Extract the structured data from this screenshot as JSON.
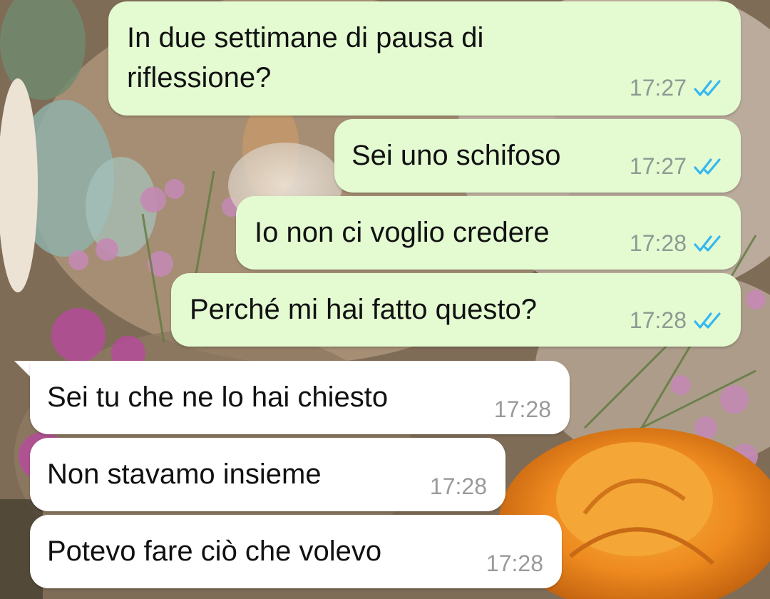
{
  "theme": {
    "outgoing_bubble": "#e4fbd2",
    "incoming_bubble": "#ffffff",
    "read_ticks": "#34b7f1"
  },
  "messages": [
    {
      "direction": "outgoing",
      "lines": [
        "In due settimane di pausa di",
        "riflessione?"
      ],
      "time": "17:27",
      "status": "read"
    },
    {
      "direction": "outgoing",
      "lines": [
        "Sei uno schifoso"
      ],
      "time": "17:27",
      "status": "read"
    },
    {
      "direction": "outgoing",
      "lines": [
        "Io non ci voglio credere"
      ],
      "time": "17:28",
      "status": "read"
    },
    {
      "direction": "outgoing",
      "lines": [
        "Perché mi hai fatto questo?"
      ],
      "time": "17:28",
      "status": "read"
    },
    {
      "direction": "incoming",
      "lines": [
        "Sei tu che ne lo hai chiesto"
      ],
      "time": "17:28"
    },
    {
      "direction": "incoming",
      "lines": [
        "Non stavamo insieme"
      ],
      "time": "17:28"
    },
    {
      "direction": "incoming",
      "lines": [
        "Potevo fare ciò che volevo"
      ],
      "time": "17:28"
    }
  ]
}
